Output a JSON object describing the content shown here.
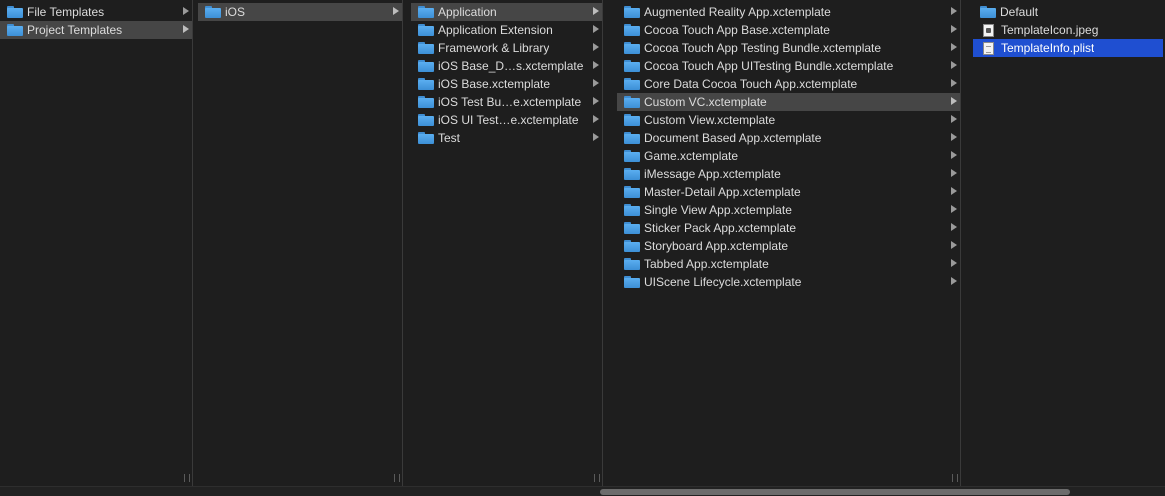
{
  "columns": [
    {
      "items": [
        {
          "label": "File Templates",
          "kind": "folder",
          "has_children": true,
          "state": "none"
        },
        {
          "label": "Project Templates",
          "kind": "folder",
          "has_children": true,
          "state": "selected"
        }
      ]
    },
    {
      "items": [
        {
          "label": "iOS",
          "kind": "folder",
          "has_children": true,
          "state": "selected"
        }
      ]
    },
    {
      "items": [
        {
          "label": "Application",
          "kind": "folder",
          "has_children": true,
          "state": "selected"
        },
        {
          "label": "Application Extension",
          "kind": "folder",
          "has_children": true,
          "state": "none"
        },
        {
          "label": "Framework & Library",
          "kind": "folder",
          "has_children": true,
          "state": "none"
        },
        {
          "label": "iOS Base_D…s.xctemplate",
          "kind": "folder",
          "has_children": true,
          "state": "none"
        },
        {
          "label": "iOS Base.xctemplate",
          "kind": "folder",
          "has_children": true,
          "state": "none"
        },
        {
          "label": "iOS Test Bu…e.xctemplate",
          "kind": "folder",
          "has_children": true,
          "state": "none"
        },
        {
          "label": "iOS UI Test…e.xctemplate",
          "kind": "folder",
          "has_children": true,
          "state": "none"
        },
        {
          "label": "Test",
          "kind": "folder",
          "has_children": true,
          "state": "none"
        }
      ]
    },
    {
      "items": [
        {
          "label": "Augmented Reality App.xctemplate",
          "kind": "folder",
          "has_children": true,
          "state": "none"
        },
        {
          "label": "Cocoa Touch App Base.xctemplate",
          "kind": "folder",
          "has_children": true,
          "state": "none"
        },
        {
          "label": "Cocoa Touch App Testing Bundle.xctemplate",
          "kind": "folder",
          "has_children": true,
          "state": "none"
        },
        {
          "label": "Cocoa Touch App UITesting Bundle.xctemplate",
          "kind": "folder",
          "has_children": true,
          "state": "none"
        },
        {
          "label": "Core Data Cocoa Touch App.xctemplate",
          "kind": "folder",
          "has_children": true,
          "state": "none"
        },
        {
          "label": "Custom VC.xctemplate",
          "kind": "folder",
          "has_children": true,
          "state": "selected"
        },
        {
          "label": "Custom View.xctemplate",
          "kind": "folder",
          "has_children": true,
          "state": "none"
        },
        {
          "label": "Document Based App.xctemplate",
          "kind": "folder",
          "has_children": true,
          "state": "none"
        },
        {
          "label": "Game.xctemplate",
          "kind": "folder",
          "has_children": true,
          "state": "none"
        },
        {
          "label": "iMessage App.xctemplate",
          "kind": "folder",
          "has_children": true,
          "state": "none"
        },
        {
          "label": "Master-Detail App.xctemplate",
          "kind": "folder",
          "has_children": true,
          "state": "none"
        },
        {
          "label": "Single View App.xctemplate",
          "kind": "folder",
          "has_children": true,
          "state": "none"
        },
        {
          "label": "Sticker Pack App.xctemplate",
          "kind": "folder",
          "has_children": true,
          "state": "none"
        },
        {
          "label": "Storyboard App.xctemplate",
          "kind": "folder",
          "has_children": true,
          "state": "none"
        },
        {
          "label": "Tabbed App.xctemplate",
          "kind": "folder",
          "has_children": true,
          "state": "none"
        },
        {
          "label": "UIScene Lifecycle.xctemplate",
          "kind": "folder",
          "has_children": true,
          "state": "none"
        }
      ]
    },
    {
      "items": [
        {
          "label": "Default",
          "kind": "folder",
          "has_children": false,
          "state": "none"
        },
        {
          "label": "TemplateIcon.jpeg",
          "kind": "image",
          "has_children": false,
          "state": "none"
        },
        {
          "label": "TemplateInfo.plist",
          "kind": "document",
          "has_children": false,
          "state": "active"
        }
      ]
    }
  ],
  "colors": {
    "background": "#1e1e1e",
    "selected_row": "#464646",
    "active_selection": "#1f4fd1",
    "folder": "#4a9fe6"
  }
}
